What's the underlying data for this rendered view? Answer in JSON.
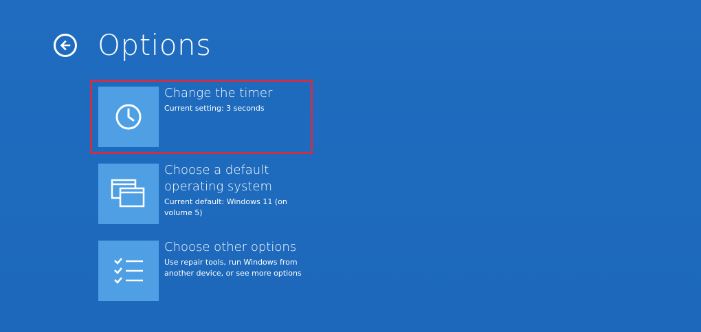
{
  "header": {
    "title": "Options",
    "back_icon": "back-arrow-icon"
  },
  "options": [
    {
      "title": "Change the timer",
      "description": "Current setting: 3 seconds",
      "icon": "clock-icon"
    },
    {
      "title": "Choose a default operating system",
      "description": "Current default: Windows 11 (on volume 5)",
      "icon": "windows-stack-icon"
    },
    {
      "title": "Choose other options",
      "description": "Use repair tools, run Windows from another device, or see more options",
      "icon": "checklist-icon"
    }
  ],
  "colors": {
    "background": "#1e6bbf",
    "tile": "#4f9fe5",
    "highlight": "#c8314c"
  }
}
